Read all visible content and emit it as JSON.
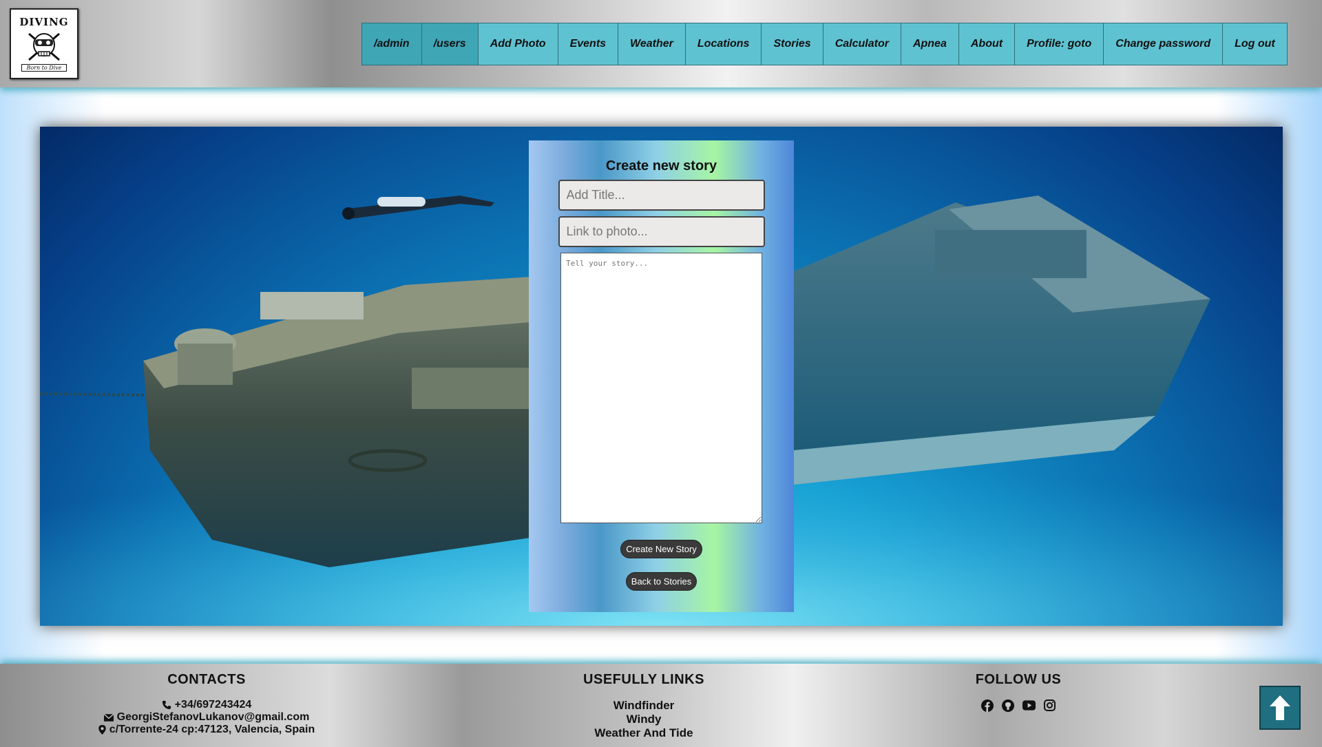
{
  "header": {
    "logo": {
      "title": "DIVING",
      "banner": "Born to Dive"
    },
    "nav": [
      {
        "label": "/admin",
        "dark": true
      },
      {
        "label": "/users",
        "dark": true
      },
      {
        "label": "Add Photo",
        "dark": false
      },
      {
        "label": "Events",
        "dark": false
      },
      {
        "label": "Weather",
        "dark": false
      },
      {
        "label": "Locations",
        "dark": false
      },
      {
        "label": "Stories",
        "dark": false
      },
      {
        "label": "Calculator",
        "dark": false
      },
      {
        "label": "Apnea",
        "dark": false
      },
      {
        "label": "About",
        "dark": false
      },
      {
        "label": "Profile: goto",
        "dark": false
      },
      {
        "label": "Change password",
        "dark": false
      },
      {
        "label": "Log out",
        "dark": false
      }
    ]
  },
  "form": {
    "title": "Create new story",
    "title_placeholder": "Add Title...",
    "photo_placeholder": "Link to photo...",
    "story_placeholder": "Tell your story...",
    "create_label": "Create New Story",
    "back_label": "Back to Stories"
  },
  "footer": {
    "contacts": {
      "heading": "CONTACTS",
      "phone": "+34/697243424",
      "email": "GeorgiStefanovLukanov@gmail.com",
      "address": "c/Torrente-24 cp:47123, Valencia, Spain",
      "icons": [
        "phone-icon",
        "envelope-icon",
        "map-pin-icon"
      ]
    },
    "links": {
      "heading": "USEFULLY LINKS",
      "items": [
        "Windfinder",
        "Windy",
        "Weather And Tide"
      ]
    },
    "follow": {
      "heading": "FOLLOW US",
      "icons": [
        "facebook-icon",
        "github-icon",
        "youtube-icon",
        "instagram-icon"
      ]
    }
  },
  "scroll_top_icon": "arrow-up-icon",
  "colors": {
    "nav_item": "#5fc2d1",
    "nav_item_active": "#3fa6b6",
    "button": "#3a3a3a",
    "scroll_top": "#1f6f80"
  }
}
